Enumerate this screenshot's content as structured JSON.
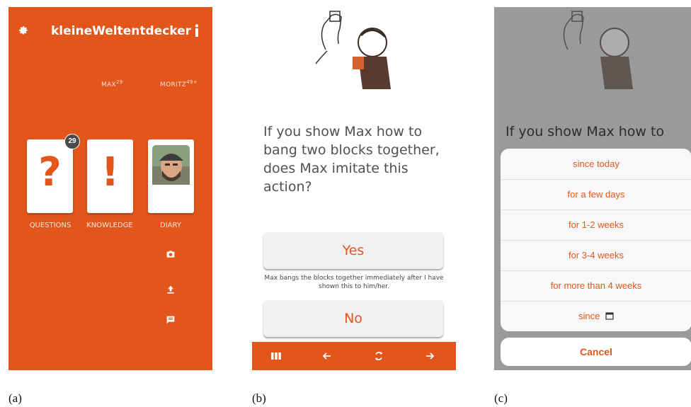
{
  "screen_a": {
    "title": "kleineWeltentdecker",
    "profiles": [
      {
        "name": "MAX",
        "age": "29"
      },
      {
        "name": "MORITZ",
        "age": "49+"
      }
    ],
    "cards": [
      {
        "glyph": "?",
        "label": "QUESTIONS",
        "badge": "29"
      },
      {
        "glyph": "!",
        "label": "KNOWLEDGE"
      },
      {
        "label": "DIARY"
      }
    ],
    "icons": [
      "gear-icon",
      "info-icon",
      "camera-icon",
      "upload-icon",
      "comment-icon"
    ],
    "accent": "#e2561b"
  },
  "screen_b": {
    "question": "If you show Max how to bang two blocks together, does Max imitate this action?",
    "yes_label": "Yes",
    "yes_hint": "Max bangs the blocks together immediately after I have shown this to him/her.",
    "no_label": "No",
    "bottom_icons": [
      "menu-icon",
      "arrow-left-icon",
      "refresh-icon",
      "arrow-right-icon"
    ]
  },
  "screen_c": {
    "question_partial": "If you show Max how to",
    "options": [
      "since today",
      "for a few days",
      "for 1-2 weeks",
      "for 3-4 weeks",
      "for more than 4 weeks",
      "since"
    ],
    "cancel_label": "Cancel"
  },
  "captions": [
    "(a)",
    "(b)",
    "(c)"
  ]
}
